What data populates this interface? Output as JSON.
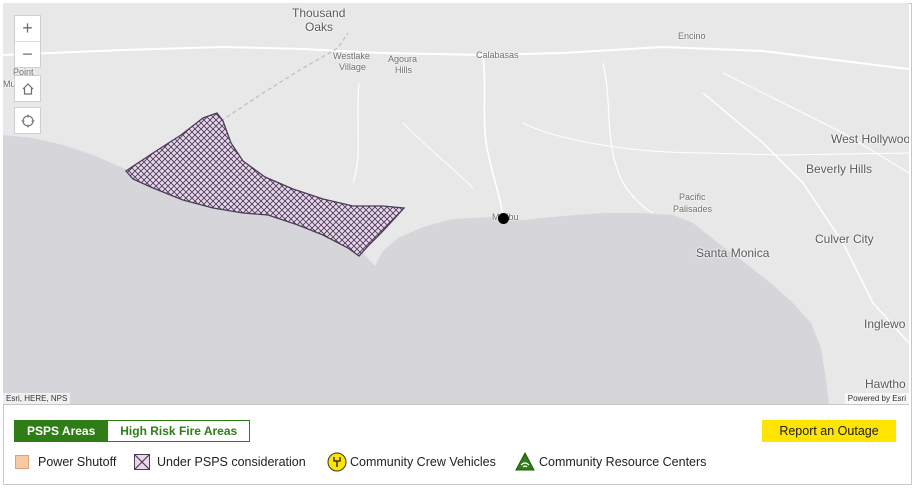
{
  "map": {
    "labels": {
      "thousand_oaks_1": "Thousand",
      "thousand_oaks_2": "Oaks",
      "westlake_1": "Westlake",
      "westlake_2": "Village",
      "agoura_1": "Agoura",
      "agoura_2": "Hills",
      "calabasas": "Calabasas",
      "encino": "Encino",
      "point_mugu_1": "Point",
      "point_mugu_2": "Mu      ws",
      "west_hollywood": "West Hollywood",
      "beverly_hills": "Beverly Hills",
      "pacific_palisades_1": "Pacific",
      "pacific_palisades_2": "Palisades",
      "malibu": "Malibu",
      "santa_monica": "Santa Monica",
      "culver_city": "Culver City",
      "inglewood": "Inglewo",
      "hawthorne": "Hawtho"
    },
    "attribution_left": "Esri, HERE, NPS",
    "attribution_right": "Powered by Esri",
    "controls": {
      "zoom_in_icon": "+",
      "zoom_out_icon": "−"
    },
    "colors": {
      "land": "#e8e8e8",
      "water": "#d6d6da",
      "psps_fill": "#e9d8ec",
      "psps_stroke": "#4a3a55"
    }
  },
  "tabs": {
    "psps_areas": "PSPS Areas",
    "high_risk_fire_areas": "High Risk Fire Areas",
    "active": "psps_areas"
  },
  "report_outage_button": "Report an Outage",
  "legend": {
    "power_shutoff": "Power Shutoff",
    "under_psps": "Under PSPS consideration",
    "crew_vehicles": "Community Crew Vehicles",
    "resource_centers": "Community Resource Centers"
  }
}
